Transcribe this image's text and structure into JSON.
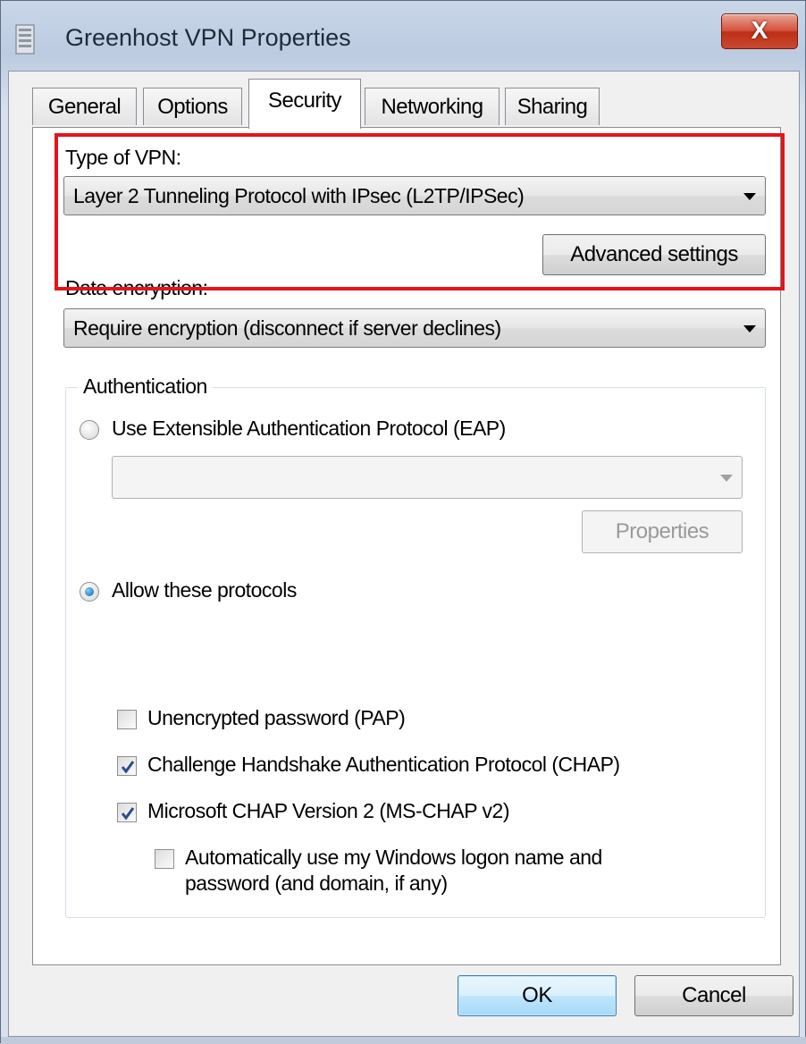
{
  "window": {
    "title": "Greenhost VPN Properties",
    "close_glyph": "X"
  },
  "tabs": [
    {
      "label": "General",
      "active": false
    },
    {
      "label": "Options",
      "active": false
    },
    {
      "label": "Security",
      "active": true
    },
    {
      "label": "Networking",
      "active": false
    },
    {
      "label": "Sharing",
      "active": false
    }
  ],
  "security": {
    "vpn_type_label": "Type of VPN:",
    "vpn_type_value": "Layer 2 Tunneling Protocol with IPsec (L2TP/IPSec)",
    "advanced_settings_label": "Advanced settings",
    "data_encryption_label": "Data encryption:",
    "data_encryption_value": "Require encryption (disconnect if server declines)",
    "authentication": {
      "group_title": "Authentication",
      "eap_label": "Use Extensible Authentication Protocol (EAP)",
      "eap_selected": false,
      "eap_combo_value": "",
      "properties_label": "Properties",
      "allow_label": "Allow these protocols",
      "allow_selected": true,
      "protocols": [
        {
          "label": "Unencrypted password (PAP)",
          "checked": false
        },
        {
          "label": "Challenge Handshake Authentication Protocol (CHAP)",
          "checked": true
        },
        {
          "label": "Microsoft CHAP Version 2 (MS-CHAP v2)",
          "checked": true
        }
      ],
      "auto_logon_line1": "Automatically use my Windows logon name and",
      "auto_logon_line2": "password (and domain, if any)",
      "auto_logon_checked": false
    }
  },
  "buttons": {
    "ok": "OK",
    "cancel": "Cancel"
  },
  "colors": {
    "highlight": "#e4141b",
    "close_button": "#c9492e",
    "default_button_border": "#3c7fb1"
  }
}
